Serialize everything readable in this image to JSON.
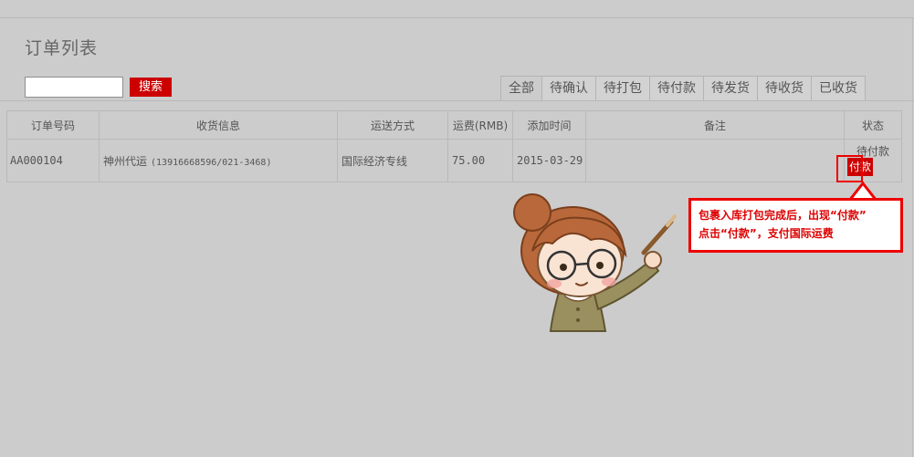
{
  "page": {
    "title": "订单列表"
  },
  "search": {
    "value": "",
    "placeholder": "",
    "button_label": "搜索"
  },
  "tabs": [
    {
      "label": "全部",
      "active": true
    },
    {
      "label": "待确认",
      "active": false
    },
    {
      "label": "待打包",
      "active": false
    },
    {
      "label": "待付款",
      "active": false
    },
    {
      "label": "待发货",
      "active": false
    },
    {
      "label": "待收货",
      "active": false
    },
    {
      "label": "已收货",
      "active": false
    }
  ],
  "table": {
    "headers": {
      "order_no": "订单号码",
      "receiver": "收货信息",
      "shipping": "运送方式",
      "fee": "运费(RMB)",
      "added": "添加时间",
      "note": "备注",
      "status": "状态"
    },
    "rows": [
      {
        "order_no": "AA000104",
        "receiver_name": "神州代运",
        "receiver_phone": "(13916668596/021-3468)",
        "shipping": "国际经济专线",
        "fee": "75.00",
        "added": "2015-03-29",
        "note": "",
        "status": "待付款",
        "action_label": "付款"
      }
    ]
  },
  "callout": {
    "line1": "包裹入库打包完成后，出现“付款”",
    "line2": "点击“付款”，支付国际运费"
  },
  "colors": {
    "accent": "#cc0000",
    "highlight": "#ee0000",
    "link": "#0033aa",
    "background": "#cccccc"
  },
  "icons": {
    "mascot": "pointing-girl-illustration"
  }
}
